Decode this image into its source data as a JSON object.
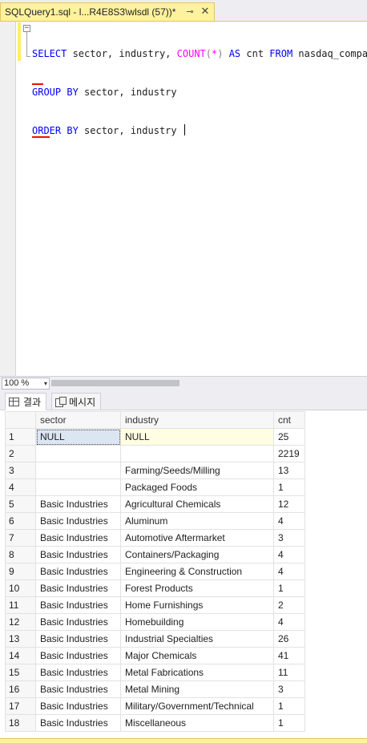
{
  "document_tab": {
    "title": "SQLQuery1.sql - l...R4E8S3\\wlsdl (57))*",
    "pin_glyph": "⊸",
    "close_glyph": "✕"
  },
  "editor": {
    "collapse_glyph": "−",
    "line1": {
      "kw_select": "SELECT",
      "cols": " sector, industry, ",
      "fn_count": "COUNT",
      "lparen": "(",
      "star": "*",
      "rparen": ")",
      "sp1": " ",
      "kw_as": "AS",
      "alias": " cnt ",
      "kw_from": "FROM",
      "table": " nasdaq_company"
    },
    "line2": {
      "kw_group": "GROUP",
      "sp": " ",
      "kw_by": "BY",
      "rest": " sector, industry"
    },
    "line3": {
      "kw_order": "ORDER",
      "sp": " ",
      "kw_by": "BY",
      "rest": " sector, industry "
    }
  },
  "zoom": {
    "value": "100 %",
    "arrow": "▾"
  },
  "results_tabs": {
    "results_label": "결과",
    "messages_label": "메시지"
  },
  "grid": {
    "headers": [
      "sector",
      "industry",
      "cnt"
    ],
    "rows": [
      [
        "1",
        "NULL",
        "NULL",
        "25"
      ],
      [
        "2",
        "",
        "",
        "2219"
      ],
      [
        "3",
        "",
        "Farming/Seeds/Milling",
        "13"
      ],
      [
        "4",
        "",
        "Packaged Foods",
        "1"
      ],
      [
        "5",
        "Basic Industries",
        "Agricultural Chemicals",
        "12"
      ],
      [
        "6",
        "Basic Industries",
        "Aluminum",
        "4"
      ],
      [
        "7",
        "Basic Industries",
        "Automotive Aftermarket",
        "3"
      ],
      [
        "8",
        "Basic Industries",
        "Containers/Packaging",
        "4"
      ],
      [
        "9",
        "Basic Industries",
        "Engineering & Construction",
        "4"
      ],
      [
        "10",
        "Basic Industries",
        "Forest Products",
        "1"
      ],
      [
        "11",
        "Basic Industries",
        "Home Furnishings",
        "2"
      ],
      [
        "12",
        "Basic Industries",
        "Homebuilding",
        "4"
      ],
      [
        "13",
        "Basic Industries",
        "Industrial Specialties",
        "26"
      ],
      [
        "14",
        "Basic Industries",
        "Major Chemicals",
        "41"
      ],
      [
        "15",
        "Basic Industries",
        "Metal Fabrications",
        "11"
      ],
      [
        "16",
        "Basic Industries",
        "Metal Mining",
        "3"
      ],
      [
        "17",
        "Basic Industries",
        "Military/Government/Technical",
        "1"
      ],
      [
        "18",
        "Basic Industries",
        "Miscellaneous",
        "1"
      ]
    ]
  },
  "colors": {
    "tab_active": "#fff29d",
    "keyword": "#0000ff",
    "function": "#ff00ff",
    "selection": "#dce6f3",
    "squiggle": "#e51400"
  }
}
